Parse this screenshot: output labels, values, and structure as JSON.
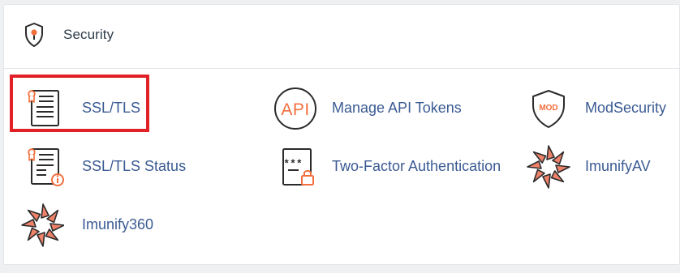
{
  "section": {
    "title": "Security",
    "icon": "shield-icon"
  },
  "items": [
    {
      "label": "SSL/TLS",
      "icon": "certificate-icon"
    },
    {
      "label": "Manage API Tokens",
      "icon": "api-icon"
    },
    {
      "label": "ModSecurity",
      "icon": "mod-shield-icon"
    },
    {
      "label": "SSL/TLS Status",
      "icon": "certificate-status-icon"
    },
    {
      "label": "Two-Factor Authentication",
      "icon": "two-factor-icon"
    },
    {
      "label": "ImunifyAV",
      "icon": "imunify-icon"
    },
    {
      "label": "Imunify360",
      "icon": "imunify360-icon"
    }
  ],
  "colors": {
    "accent": "#f26f3d",
    "outline": "#2b2b2b",
    "link": "#3a5a93",
    "highlight": "#e02228",
    "imunify": "#f0826a"
  }
}
